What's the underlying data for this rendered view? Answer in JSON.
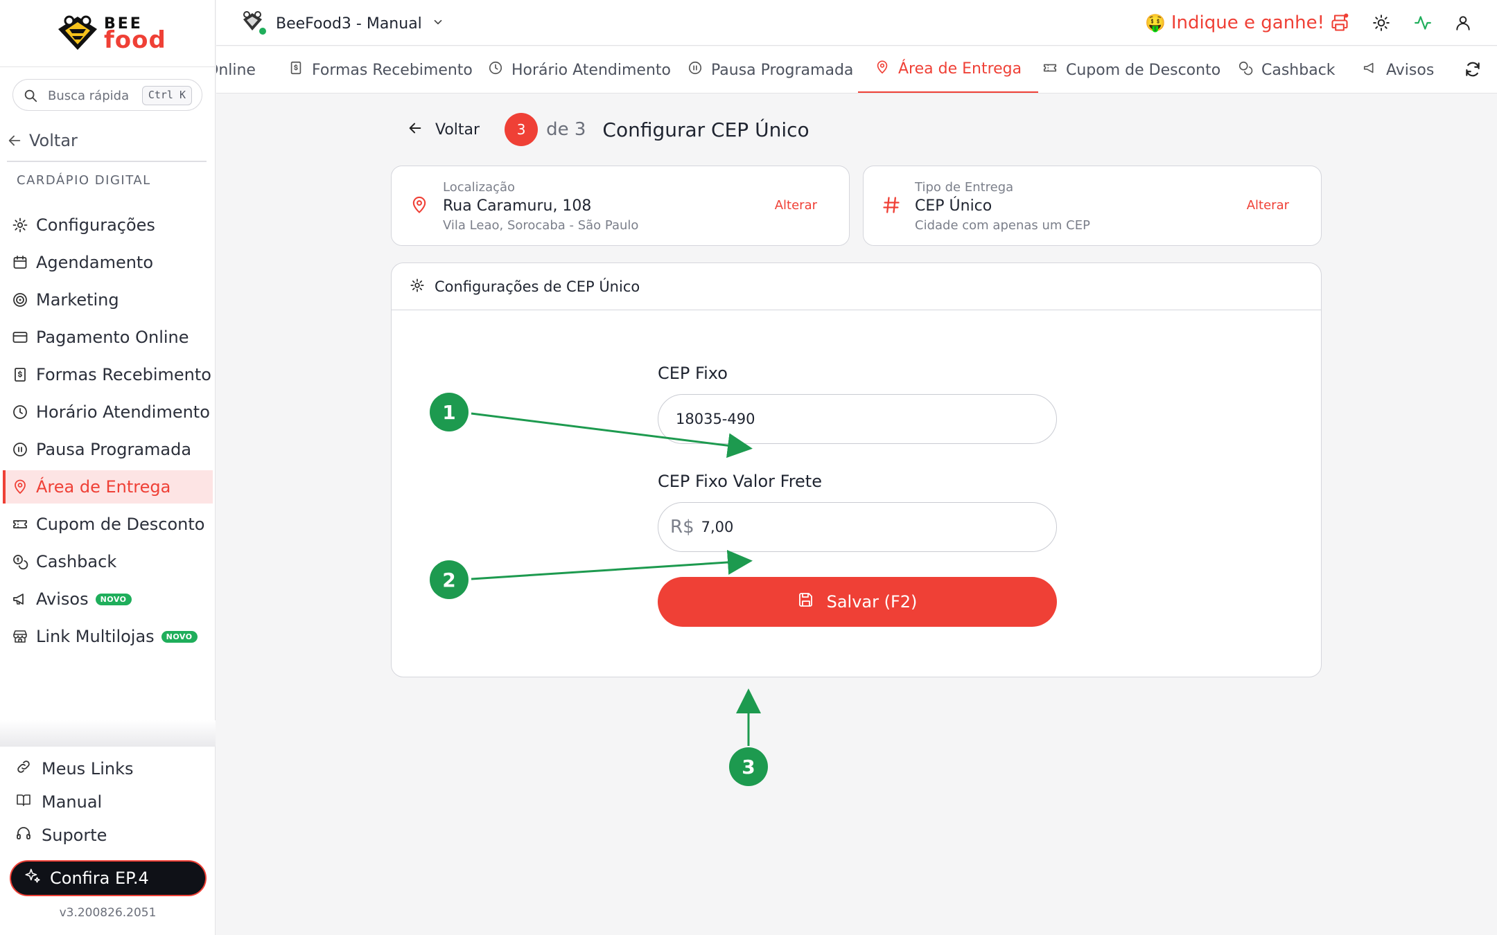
{
  "colors": {
    "accent": "#ef4036",
    "callout": "#1d9a4f",
    "badge": "#1fae5b"
  },
  "brand": {
    "top": "BEE",
    "bottom": "food"
  },
  "sidebar": {
    "search_placeholder": "Busca rápida",
    "search_shortcut": "Ctrl K",
    "back_label": "Voltar",
    "section_title": "CARDÁPIO DIGITAL",
    "items": [
      {
        "label": "Configurações",
        "icon": "gear-icon"
      },
      {
        "label": "Agendamento",
        "icon": "calendar-icon"
      },
      {
        "label": "Marketing",
        "icon": "target-icon"
      },
      {
        "label": "Pagamento Online",
        "icon": "credit-card-icon"
      },
      {
        "label": "Formas Recebimento",
        "icon": "receipt-icon"
      },
      {
        "label": "Horário Atendimento",
        "icon": "clock-icon"
      },
      {
        "label": "Pausa Programada",
        "icon": "pause-icon"
      },
      {
        "label": "Área de Entrega",
        "icon": "map-pin-icon",
        "active": true
      },
      {
        "label": "Cupom de Desconto",
        "icon": "ticket-icon"
      },
      {
        "label": "Cashback",
        "icon": "coins-icon"
      },
      {
        "label": "Avisos",
        "icon": "megaphone-icon",
        "badge": "NOVO"
      },
      {
        "label": "Link Multilojas",
        "icon": "store-icon",
        "badge": "NOVO"
      }
    ],
    "footer": [
      {
        "label": "Meus Links",
        "icon": "link-icon"
      },
      {
        "label": "Manual",
        "icon": "book-icon"
      },
      {
        "label": "Suporte",
        "icon": "headphones-icon"
      }
    ],
    "confira_label": "Confira EP.4",
    "version": "v3.200826.2051"
  },
  "header": {
    "store_name": "BeeFood3 - Manual",
    "indique_label": "Indique e ganhe!",
    "indique_emoji": "🤑"
  },
  "tabs": [
    {
      "label": "Online",
      "icon": ""
    },
    {
      "label": "Formas Recebimento",
      "icon": "receipt-icon"
    },
    {
      "label": "Horário Atendimento",
      "icon": "clock-icon"
    },
    {
      "label": "Pausa Programada",
      "icon": "pause-icon"
    },
    {
      "label": "Área de Entrega",
      "icon": "map-pin-icon",
      "active": true
    },
    {
      "label": "Cupom de Desconto",
      "icon": "ticket-icon"
    },
    {
      "label": "Cashback",
      "icon": "coins-icon"
    },
    {
      "label": "Avisos",
      "icon": "megaphone-icon"
    }
  ],
  "step": {
    "back_label": "Voltar",
    "current": "3",
    "of_label": "de 3",
    "title": "Configurar CEP Único"
  },
  "cards": {
    "location": {
      "key": "Localização",
      "value": "Rua Caramuru, 108",
      "sub": "Vila Leao, Sorocaba - São Paulo",
      "action": "Alterar"
    },
    "delivery": {
      "key": "Tipo de Entrega",
      "value": "CEP Único",
      "sub": "Cidade com apenas um CEP",
      "action": "Alterar"
    }
  },
  "config": {
    "title": "Configurações de CEP Único",
    "cep_label": "CEP Fixo",
    "cep_value": "18035-490",
    "frete_label": "CEP Fixo Valor Frete",
    "frete_prefix": "R$",
    "frete_value": "7,00",
    "save_label": "Salvar (F2)"
  },
  "callouts": [
    "1",
    "2",
    "3"
  ]
}
